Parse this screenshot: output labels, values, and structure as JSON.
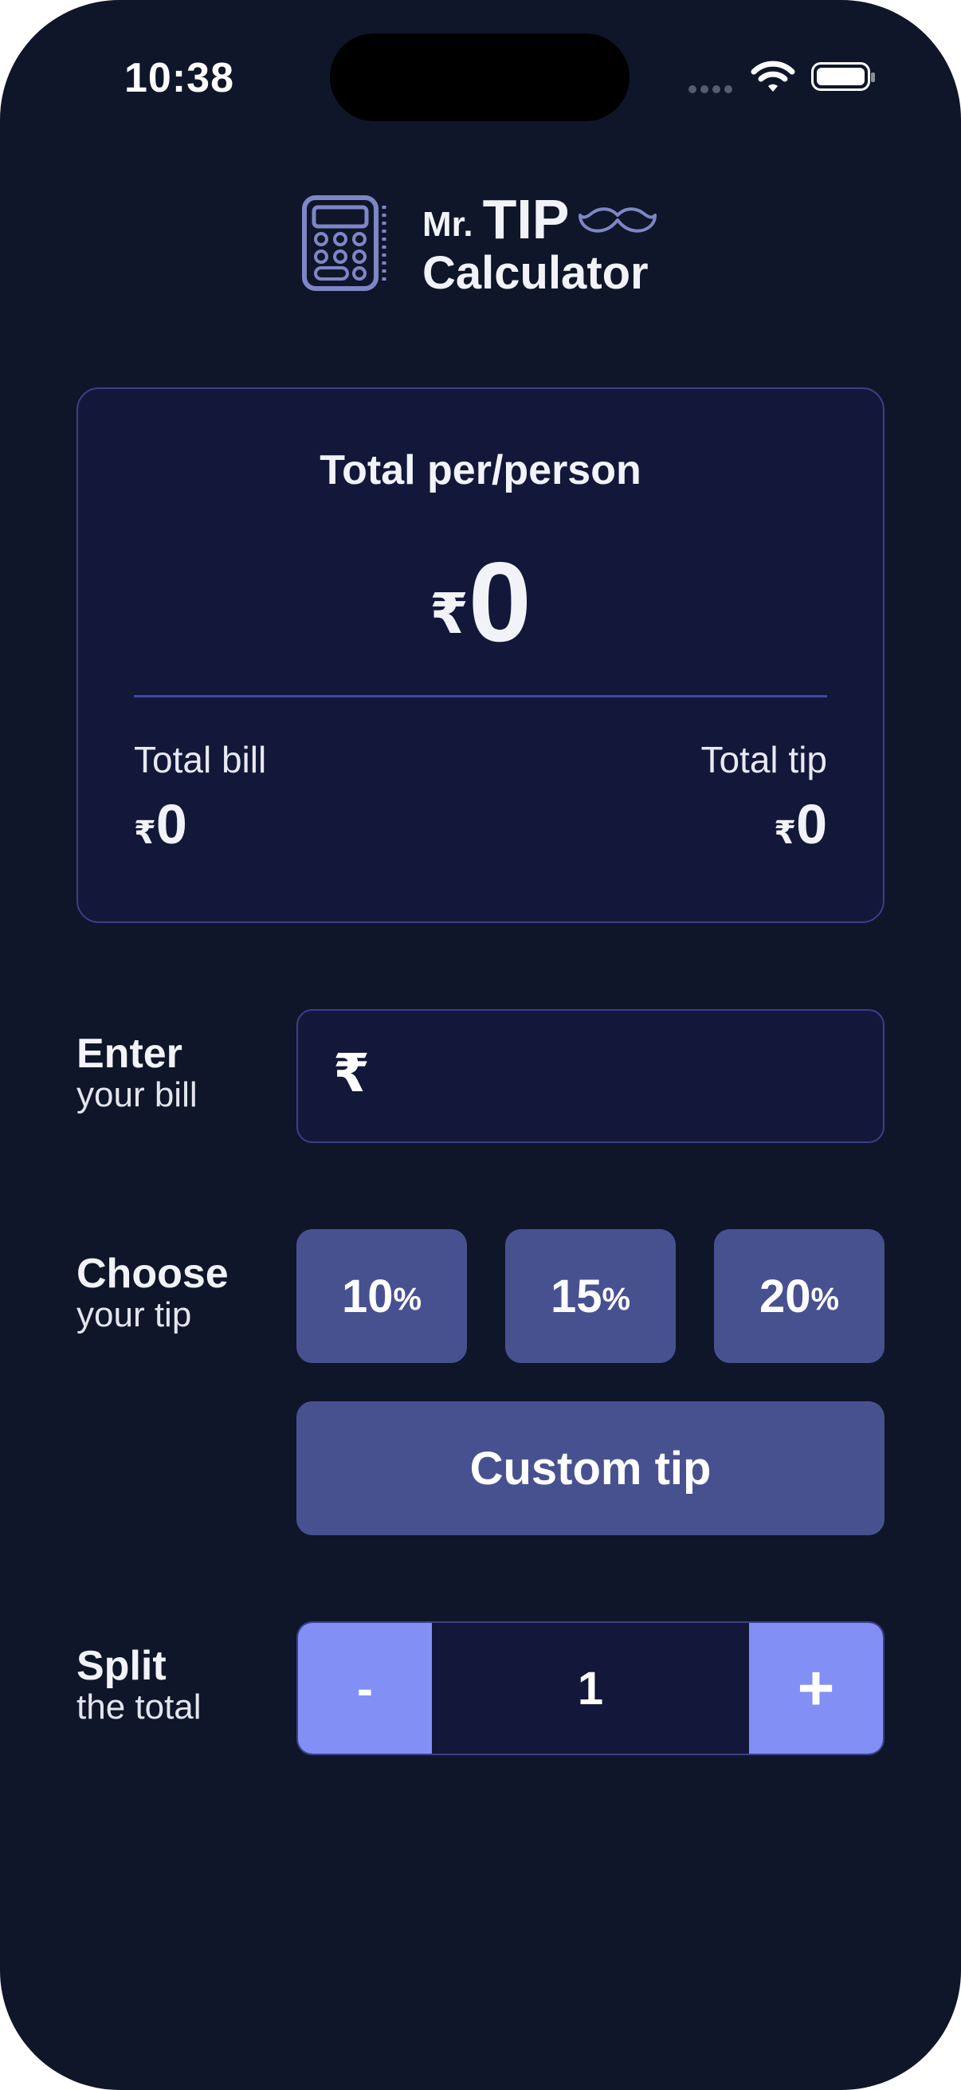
{
  "status_bar": {
    "time": "10:38"
  },
  "logo": {
    "mr": "Mr.",
    "tip": "TIP",
    "calculator": "Calculator"
  },
  "result_card": {
    "title": "Total per/person",
    "currency_symbol": "₹",
    "per_person_value": "0",
    "total_bill_label": "Total bill",
    "total_bill_value": "0",
    "total_tip_label": "Total tip",
    "total_tip_value": "0"
  },
  "bill": {
    "label_strong": "Enter",
    "label_light": "your bill",
    "currency_symbol": "₹",
    "value": "",
    "placeholder": ""
  },
  "tip": {
    "label_strong": "Choose",
    "label_light": "your tip",
    "options": [
      {
        "number": "10",
        "suffix": "%"
      },
      {
        "number": "15",
        "suffix": "%"
      },
      {
        "number": "20",
        "suffix": "%"
      }
    ],
    "custom_label": "Custom tip"
  },
  "split": {
    "label_strong": "Split",
    "label_light": "the total",
    "minus_label": "-",
    "plus_label": "+",
    "value": "1"
  },
  "colors": {
    "background": "#0f1629",
    "card": "#13183a",
    "card_border": "#3a3f8a",
    "tip_button": "#485190",
    "stepper_button": "#8290f5",
    "logo_icon": "#7f86c6"
  }
}
